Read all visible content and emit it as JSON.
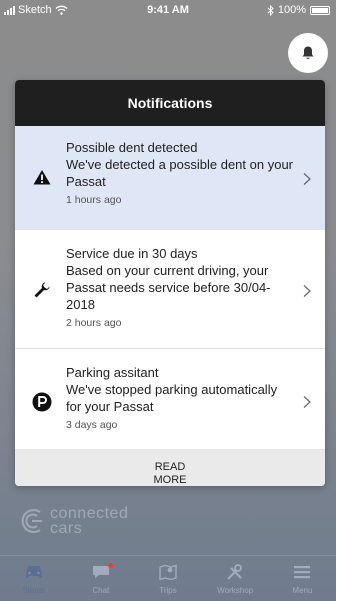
{
  "status_bar": {
    "carrier": "Sketch",
    "time": "9:41 AM",
    "battery": "100%"
  },
  "notifications": {
    "title": "Notifications",
    "items": [
      {
        "title": "Possible dent detected",
        "body": "We've detected a possible dent on your Passat",
        "time": "1 hours ago",
        "icon": "warning-icon"
      },
      {
        "title": "Service due in 30 days",
        "body": "Based on your current driving, your Passat needs service before 30/04-2018",
        "time": "2 hours ago",
        "icon": "wrench-icon"
      },
      {
        "title": "Parking assitant",
        "body": "We've stopped parking automatically for your Passat",
        "time": "3 days ago",
        "icon": "parking-icon"
      }
    ],
    "read_more": "READ MORE"
  },
  "logo": {
    "line1": "connected",
    "line2": "cars"
  },
  "tabs": [
    {
      "label": "Status",
      "icon": "car-icon",
      "active": true
    },
    {
      "label": "Chat",
      "icon": "chat-icon",
      "active": false
    },
    {
      "label": "Trips",
      "icon": "map-icon",
      "active": false
    },
    {
      "label": "Workshop",
      "icon": "tools-icon",
      "active": false
    },
    {
      "label": "Menu",
      "icon": "menu-icon",
      "active": false
    }
  ],
  "colors": {
    "header": "#1f1f1f",
    "highlight": "#dfe6f5",
    "accent": "#5a6f93",
    "badge": "#e2432a"
  }
}
